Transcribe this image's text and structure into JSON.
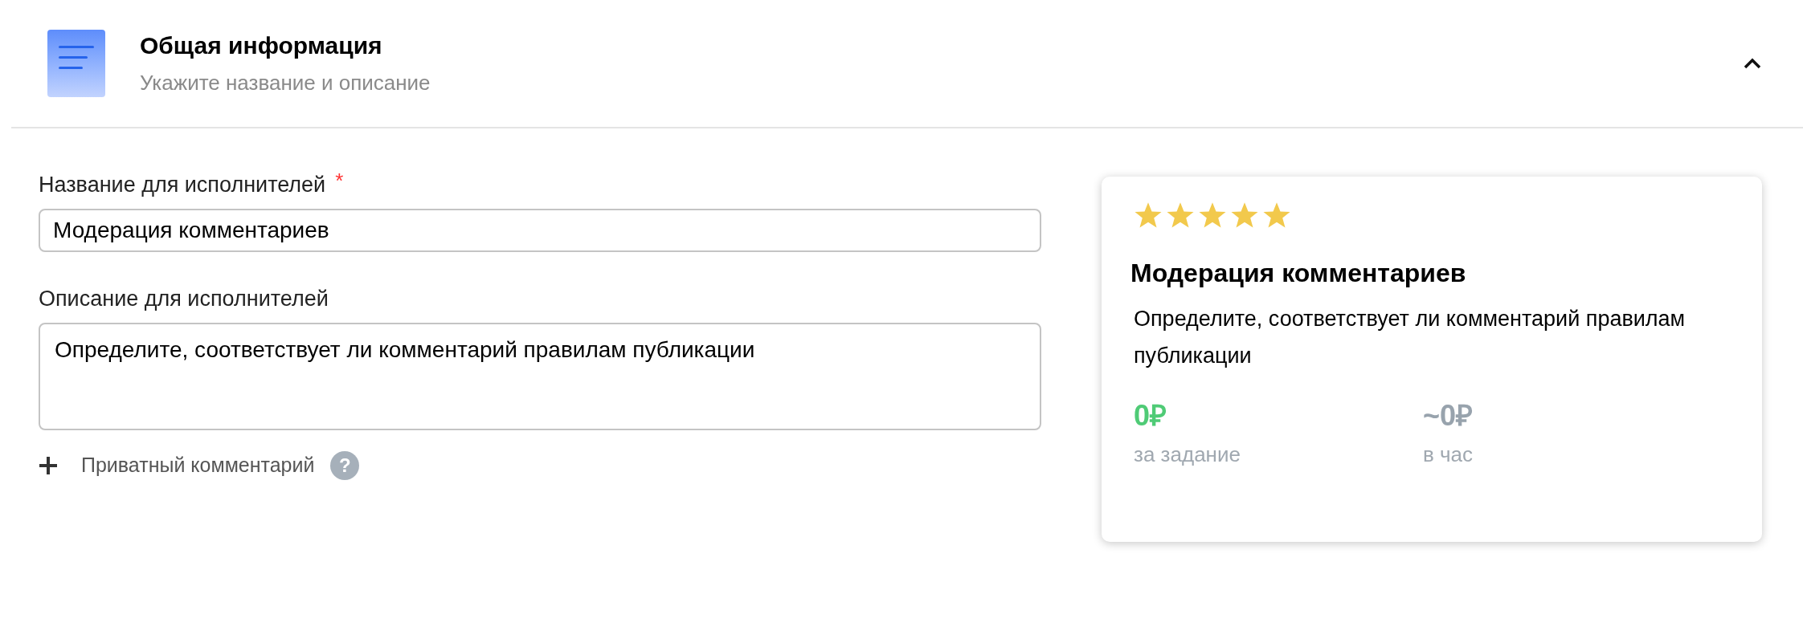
{
  "section": {
    "title": "Общая информация",
    "subtitle": "Укажите название и описание",
    "expanded": true
  },
  "name_field": {
    "label": "Название для исполнителей",
    "required_mark": "*",
    "value": "Модерация комментариев"
  },
  "description_field": {
    "label": "Описание для исполнителей",
    "value": "Определите, соответствует ли комментарий правилам публикации"
  },
  "private_comment": {
    "label": "Приватный комментарий",
    "help": "?"
  },
  "preview_card": {
    "stars": 5,
    "title": "Модерация комментариев",
    "description": "Определите, соответствует ли комментарий правилам публикации",
    "prices": [
      {
        "kind": "fixed",
        "value": "0₽",
        "caption": "за задание"
      },
      {
        "kind": "estimate",
        "value": "~0₽",
        "caption": "в час"
      }
    ]
  }
}
